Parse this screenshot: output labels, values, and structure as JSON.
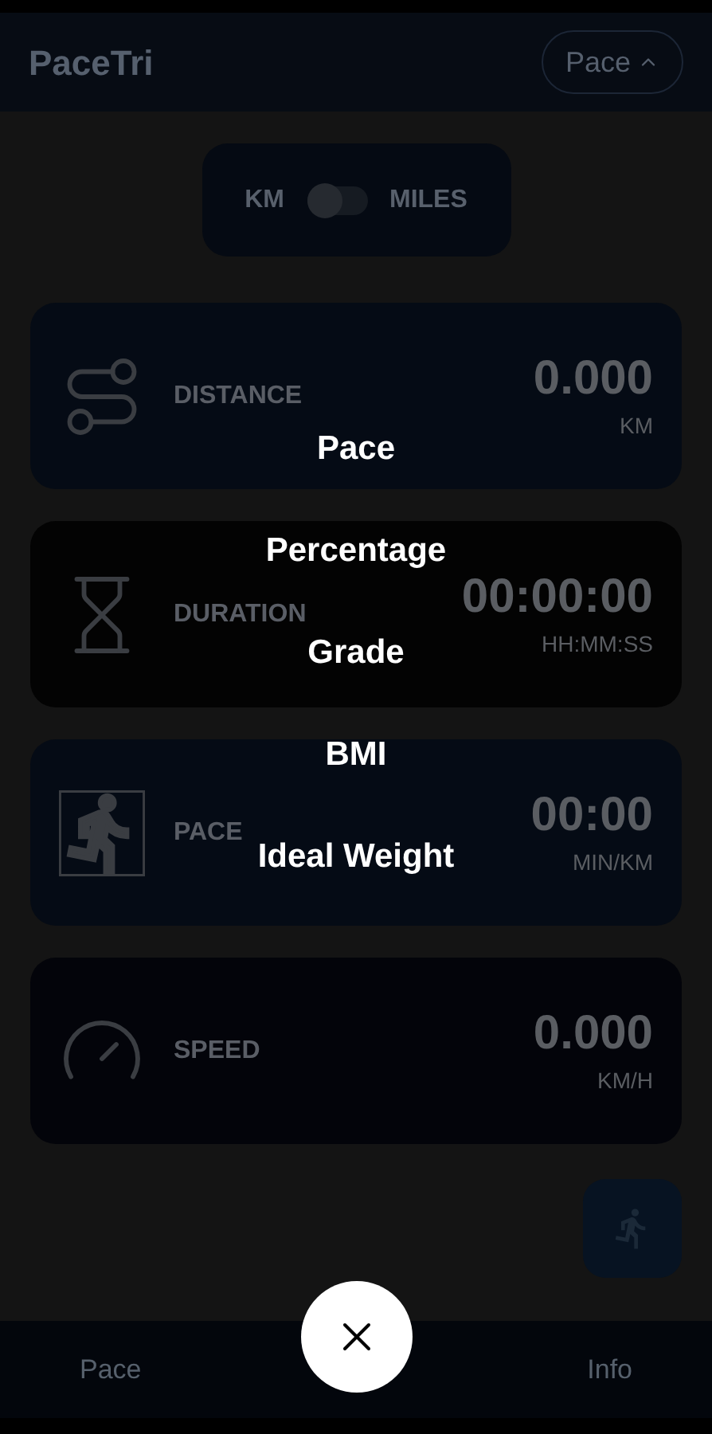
{
  "header": {
    "title": "PaceTri",
    "dropdown": {
      "label": "Pace",
      "expanded": true
    }
  },
  "unit_toggle": {
    "left": "KM",
    "right": "MILES",
    "on": false
  },
  "cards": [
    {
      "kind": "distance",
      "label": "DISTANCE",
      "value": "0.000",
      "unit": "KM",
      "color": "#050b15"
    },
    {
      "kind": "duration",
      "label": "DURATION",
      "value": "00:00:00",
      "unit": "HH:MM:SS",
      "color": "#030303"
    },
    {
      "kind": "pace",
      "label": "PACE",
      "value": "00:00",
      "unit": "MIN/KM",
      "color": "#050b15"
    },
    {
      "kind": "speed",
      "label": "SPEED",
      "value": "0.000",
      "unit": "KM/H",
      "color": "#03040a"
    }
  ],
  "bottom_nav": [
    {
      "label": "Pace"
    },
    {
      "label": "Info"
    }
  ],
  "menu": [
    "Pace",
    "Percentage",
    "Grade",
    "BMI",
    "Ideal Weight"
  ]
}
